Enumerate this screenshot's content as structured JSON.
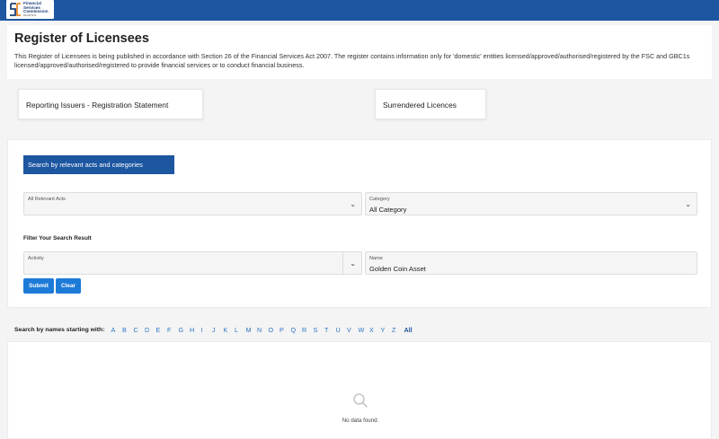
{
  "header": {
    "logo_lines": [
      "Financial",
      "Services",
      "Commission"
    ],
    "logo_sub": "MAURITIUS"
  },
  "intro": {
    "title": "Register of Licensees",
    "text": "This Register of Licensees is being published in accordance with Section 26 of the Financial Services Act 2007. The register contains information only for 'domestic' entities licensed/approved/authorised/registered by the FSC and GBC1s licensed/approved/authorised/registered to provide financial services or to conduct financial business."
  },
  "cards": {
    "reporting": "Reporting Issuers - Registration Statement",
    "surrendered": "Surrendered Licences"
  },
  "search": {
    "tab_label": "Search by relevant acts and categories",
    "acts": {
      "label": "All Relevant Acts",
      "value": ""
    },
    "category": {
      "label": "Category",
      "value": "All Category"
    },
    "filter_title": "Filter Your Search Result",
    "activity": {
      "label": "Activity",
      "value": ""
    },
    "name": {
      "label": "Name",
      "value": "Golden Coin Asset"
    },
    "submit_label": "Submit",
    "clear_label": "Clear"
  },
  "alphabet": {
    "label": "Search by names starting with:",
    "letters": [
      "A",
      "B",
      "C",
      "D",
      "E",
      "F",
      "G",
      "H",
      "I",
      "J",
      "K",
      "L",
      "M",
      "N",
      "O",
      "P",
      "Q",
      "R",
      "S",
      "T",
      "U",
      "V",
      "W",
      "X",
      "Y",
      "Z"
    ],
    "all_label": "All"
  },
  "results": {
    "empty_text": "No data found."
  },
  "colors": {
    "brand_blue": "#1d56a1",
    "button_blue": "#1d7bd8",
    "link_blue": "#2b74c7",
    "logo_orange": "#e8862a"
  },
  "icons": {
    "chevron": "chevron-down-icon",
    "empty": "search-icon"
  }
}
